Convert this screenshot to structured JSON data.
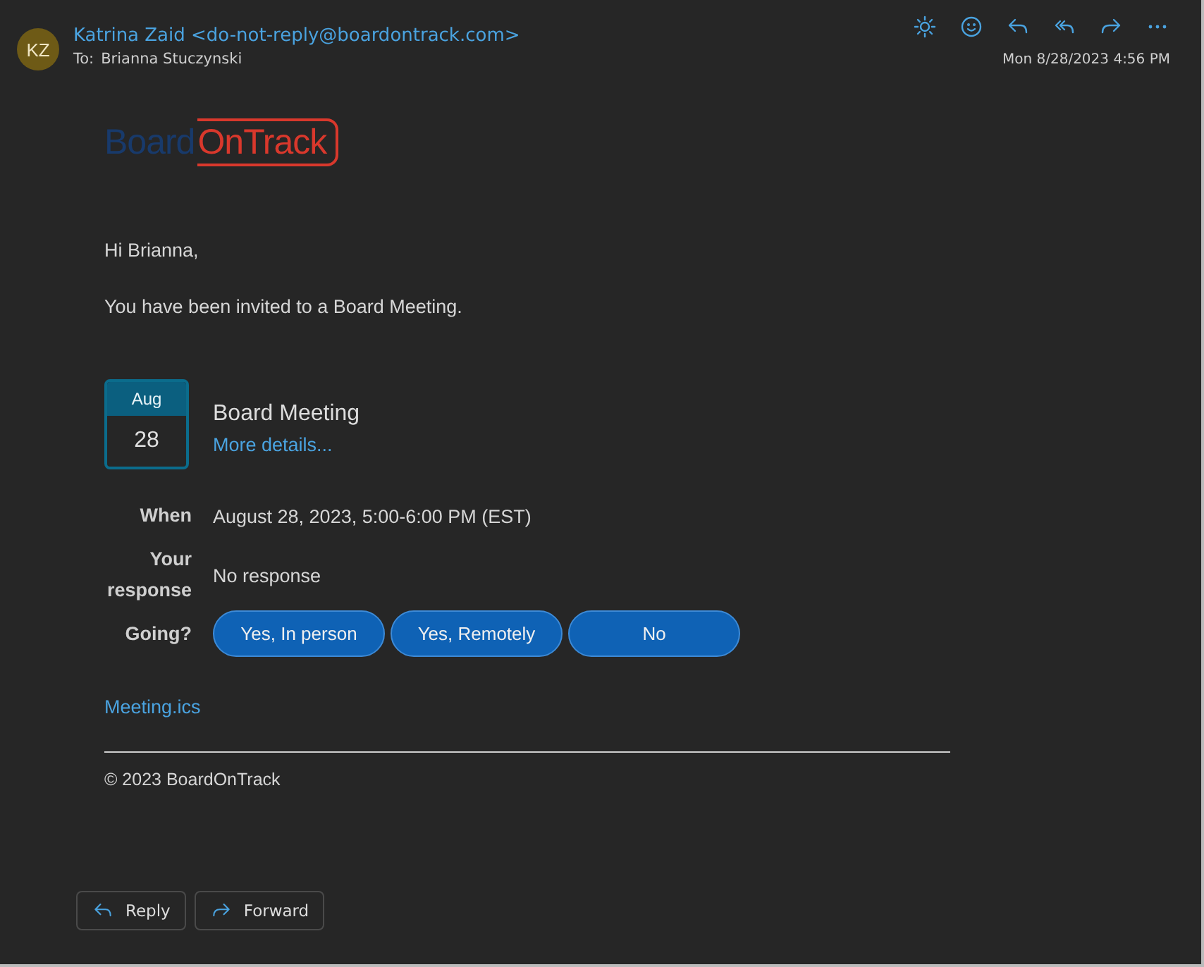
{
  "header": {
    "avatar": "KZ",
    "sender": "Katrina Zaid <do-not-reply@boardontrack.com>",
    "to_label": "To:",
    "to": "Brianna Stuczynski",
    "date": "Mon 8/28/2023 4:56 PM"
  },
  "logo": {
    "part_1": "Board",
    "part_2": "OnTrack"
  },
  "greeting": "Hi Brianna,",
  "message": "You have been invited to a Board Meeting.",
  "event": {
    "month": "Aug",
    "day": "28",
    "title": "Board Meeting",
    "link": "More details..."
  },
  "details": [
    {
      "label": "When",
      "value": "August 28, 2023, 5:00-6:00 PM (EST)"
    },
    {
      "label": "Your response",
      "value": "No response"
    }
  ],
  "going": {
    "label": "Going?",
    "options": [
      "Yes, In person",
      "Yes, Remotely",
      "No"
    ]
  },
  "attachment": "Meeting.ics",
  "footer": "© 2023 BoardOnTrack",
  "actions": [
    {
      "kind": "reply",
      "label": "Reply"
    },
    {
      "kind": "forward",
      "label": "Forward"
    }
  ]
}
